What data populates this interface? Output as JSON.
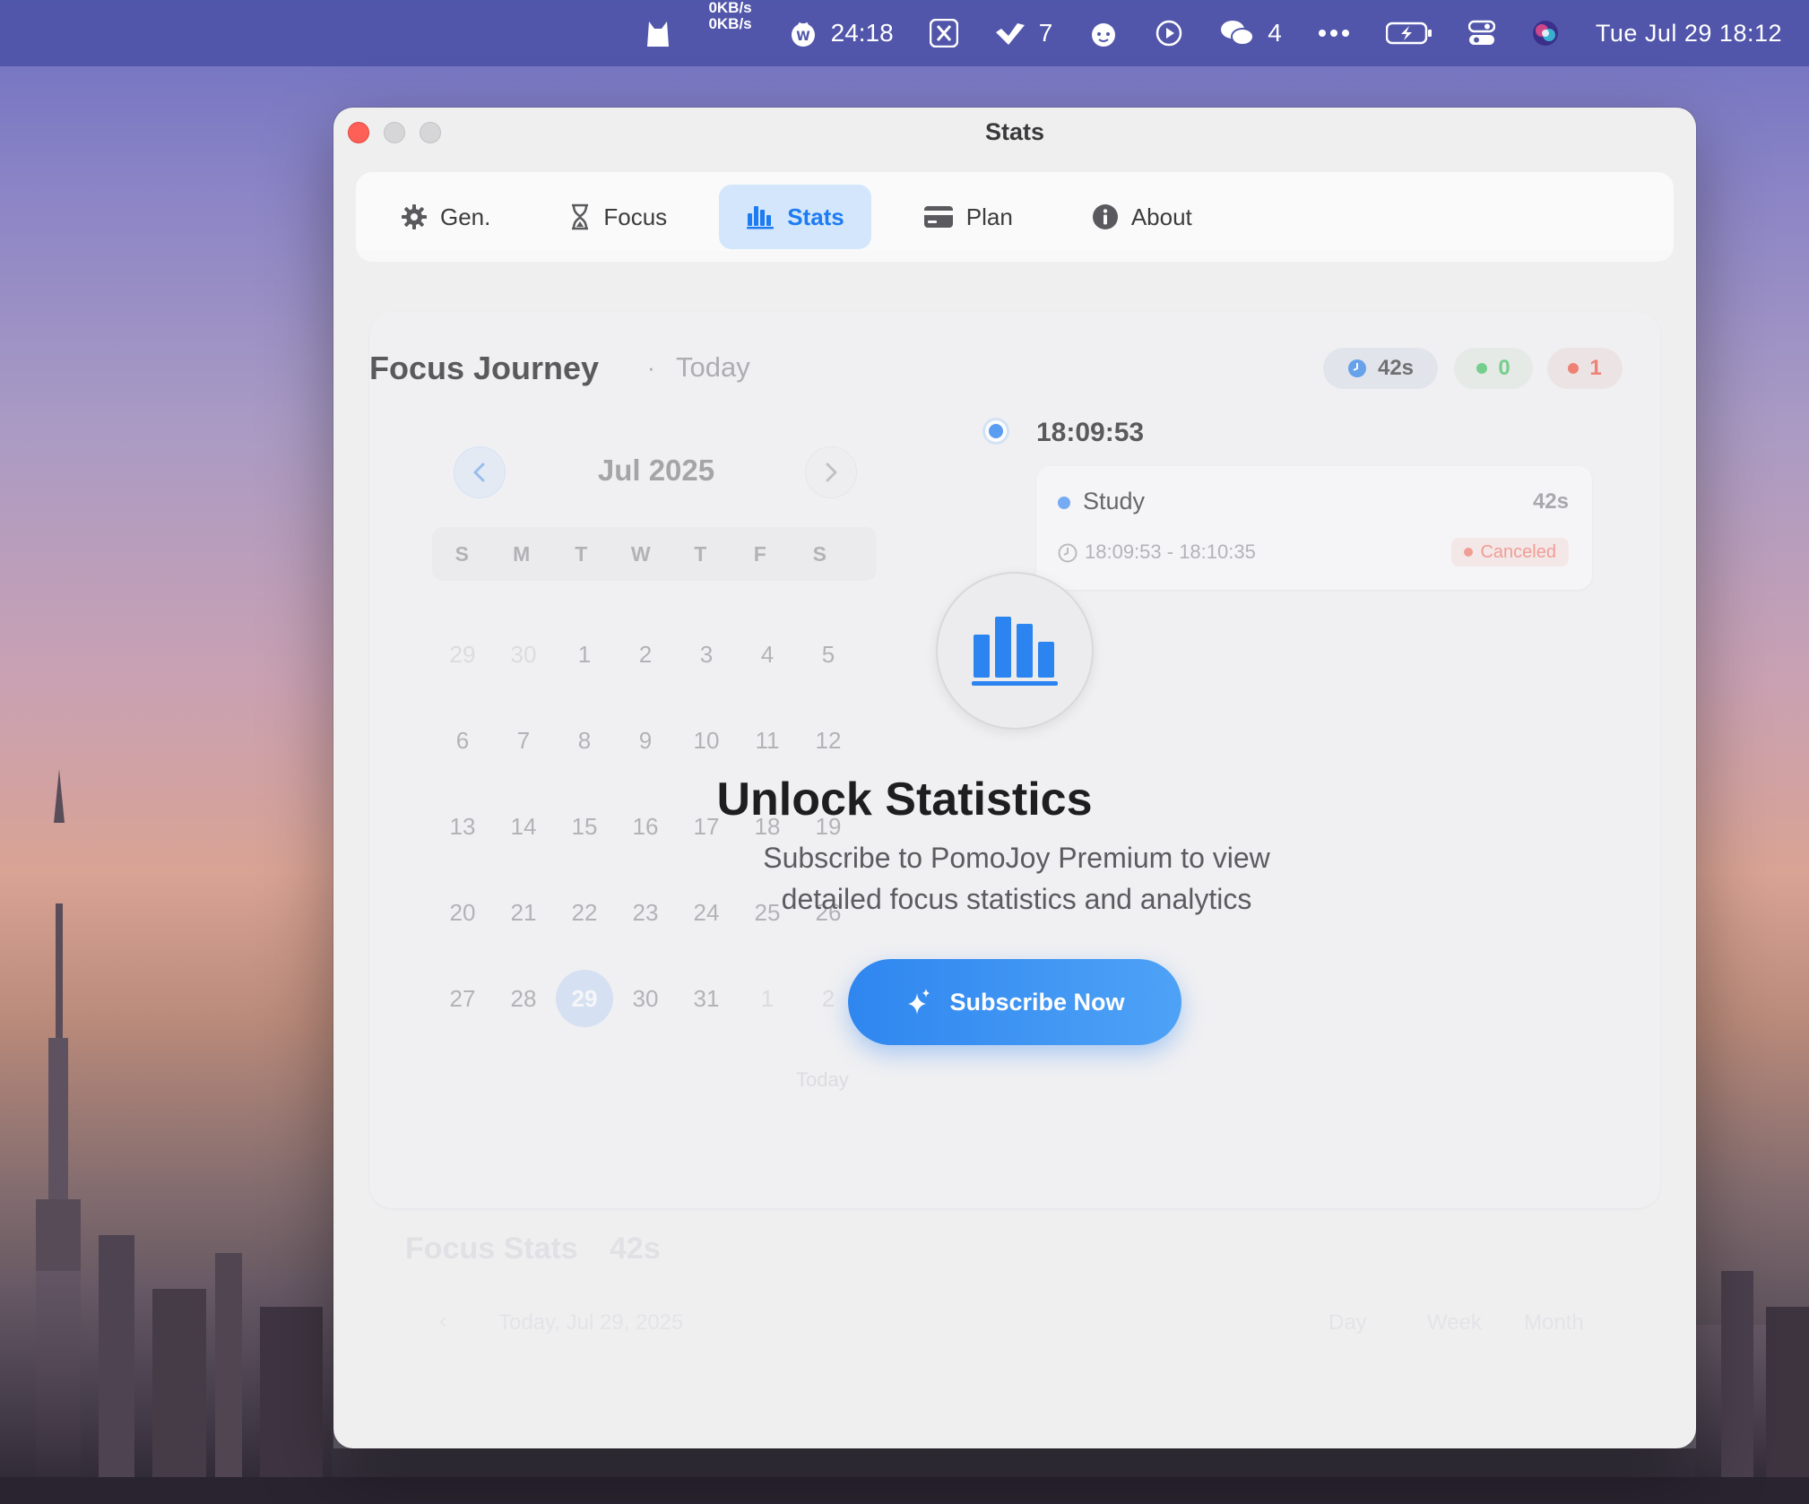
{
  "menubar": {
    "net_up": "0KB/s",
    "net_down": "0KB/s",
    "timer": "24:18",
    "inbox_count": "7",
    "wechat_count": "4",
    "clock": "Tue Jul 29  18:12"
  },
  "window": {
    "title": "Stats"
  },
  "tabs": [
    {
      "label": "Gen.",
      "icon": "gear-icon",
      "active": false
    },
    {
      "label": "Focus",
      "icon": "hourglass-icon",
      "active": false
    },
    {
      "label": "Stats",
      "icon": "bar-chart-icon",
      "active": true
    },
    {
      "label": "Plan",
      "icon": "card-icon",
      "active": false
    },
    {
      "label": "About",
      "icon": "info-icon",
      "active": false
    }
  ],
  "journey": {
    "title": "Focus Journey",
    "separator": "·",
    "period": "Today",
    "total_time": "42s",
    "completed_count": "0",
    "canceled_count": "1"
  },
  "calendar": {
    "month_label": "Jul 2025",
    "weekdays": [
      "S",
      "M",
      "T",
      "W",
      "T",
      "F",
      "S"
    ],
    "weeks": [
      [
        "29",
        "30",
        "1",
        "2",
        "3",
        "4",
        "5"
      ],
      [
        "6",
        "7",
        "8",
        "9",
        "10",
        "11",
        "12"
      ],
      [
        "13",
        "14",
        "15",
        "16",
        "17",
        "18",
        "19"
      ],
      [
        "20",
        "21",
        "22",
        "23",
        "24",
        "25",
        "26"
      ],
      [
        "27",
        "28",
        "29",
        "30",
        "31",
        "1",
        "2"
      ]
    ],
    "selected_day": "29",
    "today_link": "Today"
  },
  "timeline": {
    "time": "18:09:53",
    "session": {
      "name": "Study",
      "duration": "42s",
      "range": "18:09:53 - 18:10:35",
      "status": "Canceled"
    }
  },
  "focus_stats": {
    "title": "Focus Stats",
    "value": "42s",
    "date": "Today, Jul 29, 2025",
    "segments": [
      "Day",
      "Week",
      "Month"
    ]
  },
  "paywall": {
    "title": "Unlock Statistics",
    "description": "Subscribe to PomoJoy Premium to view detailed focus statistics and analytics",
    "button_label": "Subscribe Now"
  },
  "colors": {
    "accent": "#1d7cf2",
    "tab_active_bg": "#d3e6fb",
    "green": "#5cc776",
    "red": "#ef6a58",
    "close": "#fe5f57"
  }
}
